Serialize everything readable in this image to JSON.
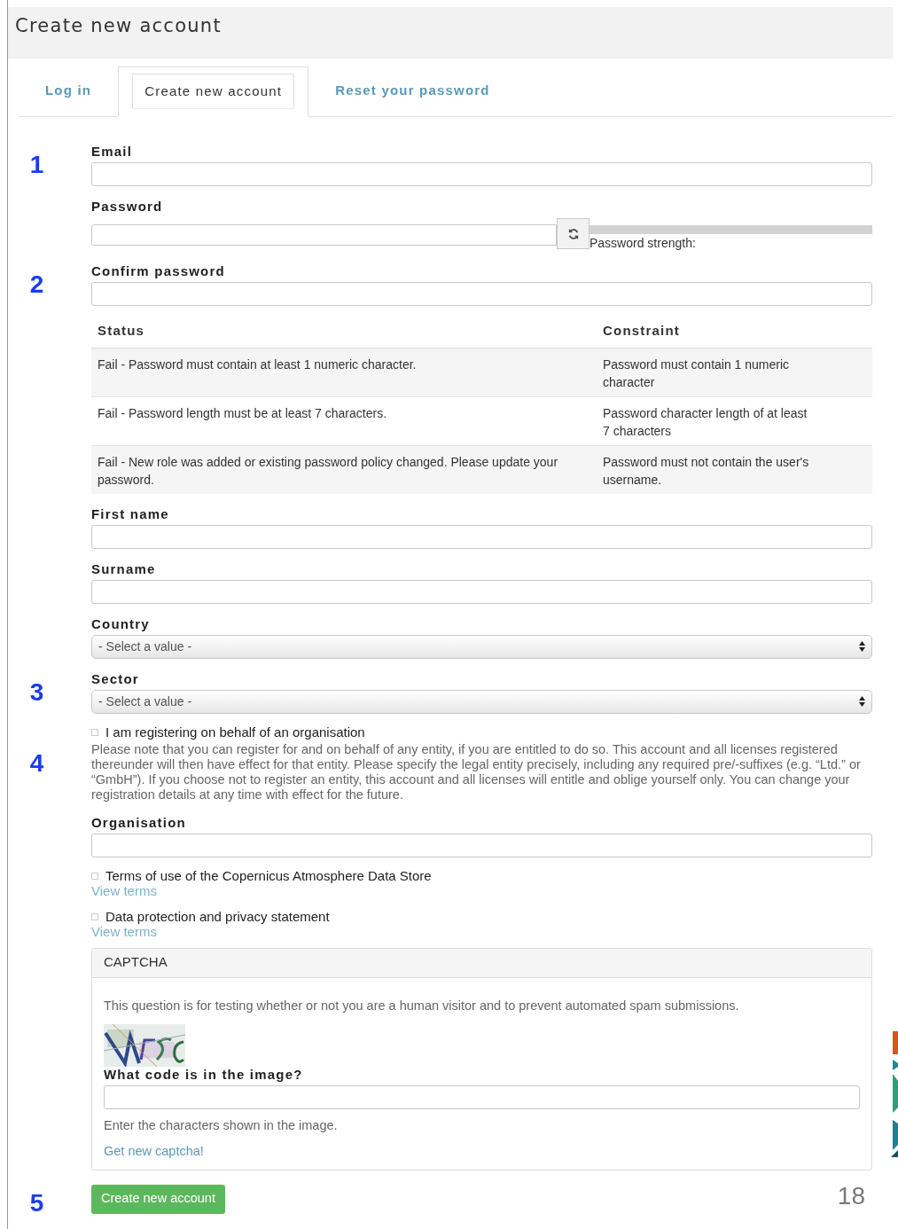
{
  "header": {
    "title": "Create new account"
  },
  "tabs": [
    {
      "label": "Log in",
      "selected": false
    },
    {
      "label": "Create new account",
      "selected": true
    },
    {
      "label": "Reset your password",
      "selected": false
    }
  ],
  "form": [
    {
      "kind": "text",
      "step": "1",
      "label": "Email"
    },
    {
      "kind": "password",
      "label": "Password",
      "strength_label": "Password strength:"
    },
    {
      "kind": "text",
      "step": "2",
      "label": "Confirm password"
    },
    {
      "kind": "table",
      "columns": [
        "Status",
        "Constraint"
      ],
      "rows": [
        [
          "Fail - Password must contain at least 1 numeric character.",
          "Password must contain 1 numeric character"
        ],
        [
          "Fail - Password length must be at least 7 characters.",
          "Password character length of at least 7 characters"
        ],
        [
          "Fail - New role was added or existing password policy changed. Please update your password.",
          "Password must not contain the user's username."
        ]
      ]
    },
    {
      "kind": "text",
      "label": "First name"
    },
    {
      "kind": "text",
      "label": "Surname"
    },
    {
      "kind": "select",
      "label": "Country",
      "value": "- Select a value -"
    },
    {
      "kind": "select",
      "step": "3",
      "label": "Sector",
      "value": "- Select a value -"
    },
    {
      "kind": "checkbox",
      "step": "4",
      "label": "I am registering on behalf of an organisation",
      "checked": false,
      "note": "Please note that you can register for and on behalf of any entity, if you are entitled to do so. This account and all licenses registered thereunder will then have effect for that entity. Please specify the legal entity precisely, including any required pre/-suffixes (e.g. “Ltd.” or “GmbH”). If you choose not to register an entity, this account and all licenses will entitle and oblige yourself only. You can change your registration details at any time with effect for the future."
    },
    {
      "kind": "text",
      "label": "Organisation"
    },
    {
      "kind": "checkbox",
      "label": "Terms of use of the Copernicus Atmosphere Data Store",
      "checked": false,
      "link": "View terms"
    },
    {
      "kind": "checkbox",
      "label": "Data protection and privacy statement",
      "checked": false,
      "link": "View terms"
    },
    {
      "kind": "captcha",
      "title": "CAPTCHA",
      "intro": "This question is for testing whether or not you are a human visitor and to prevent automated spam submissions.",
      "question": "What code is in the image?",
      "hint": "Enter the characters shown in the image.",
      "link": "Get new captcha!"
    },
    {
      "kind": "submit",
      "step": "5",
      "label": "Create new account"
    }
  ],
  "page_number": "18"
}
